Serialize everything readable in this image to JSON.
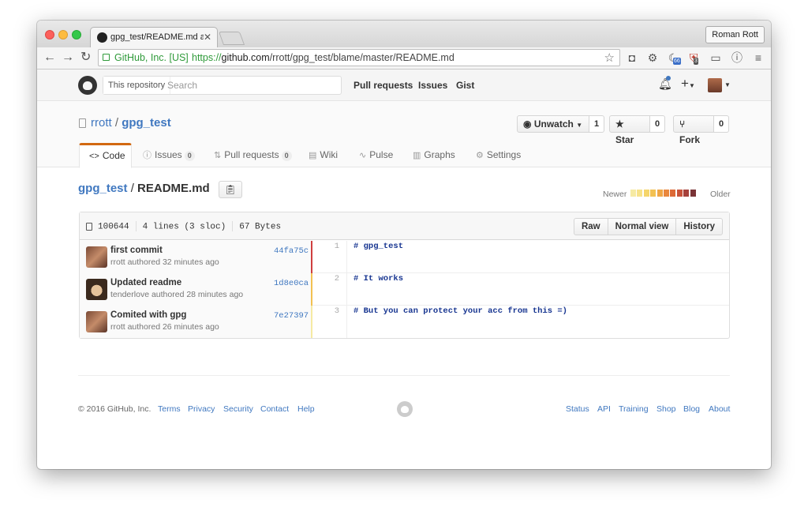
{
  "browser": {
    "tab_title": "gpg_test/README.md at m",
    "profile_name": "Roman Rott",
    "ssl_org": "GitHub, Inc. [US]",
    "url_scheme": "https://",
    "url_host": "github.com",
    "url_path": "/rrott/gpg_test/blame/master/README.md",
    "ext_badge_1": "66",
    "ext_badge_2": "3"
  },
  "header": {
    "search_scope": "This repository",
    "search_placeholder": "Search",
    "nav": [
      "Pull requests",
      "Issues",
      "Gist"
    ]
  },
  "repo": {
    "owner": "rrott",
    "separator": "/",
    "name": "gpg_test",
    "unwatch_label": "Unwatch",
    "unwatch_count": "1",
    "star_label": "Star",
    "star_count": "0",
    "fork_label": "Fork",
    "fork_count": "0"
  },
  "reponav": {
    "code": "Code",
    "issues": "Issues",
    "issues_count": "0",
    "pulls": "Pull requests",
    "pulls_count": "0",
    "wiki": "Wiki",
    "pulse": "Pulse",
    "graphs": "Graphs",
    "settings": "Settings"
  },
  "file": {
    "repo": "gpg_test",
    "separator": "/",
    "name": "README.md",
    "legend_newer": "Newer",
    "legend_older": "Older",
    "legend_colors": [
      "#f6eaa3",
      "#f7e28a",
      "#f5d56b",
      "#f3c152",
      "#efa646",
      "#e9873d",
      "#dd6a37",
      "#c8533a",
      "#a6413b",
      "#7a3437"
    ],
    "mode": "100644",
    "lines": "4 lines (3 sloc)",
    "size": "67 Bytes",
    "buttons": [
      "Raw",
      "Normal view",
      "History"
    ]
  },
  "blame": [
    {
      "message": "first commit",
      "meta": "rrott authored 32 minutes ago",
      "sha": "44fa75c",
      "line": "1",
      "code": "# gpg_test",
      "bar_color": "#cf3f3f"
    },
    {
      "message": "Updated readme",
      "meta": "tenderlove authored 28 minutes ago",
      "sha": "1d8e0ca",
      "line": "2",
      "code": "# It works",
      "bar_color": "#f3c152"
    },
    {
      "message": "Comited with gpg",
      "meta": "rrott authored 26 minutes ago",
      "sha": "7e27397",
      "line": "3",
      "code": "# But you can protect your acc from this =)",
      "bar_color": "#f6eaa3"
    }
  ],
  "footer": {
    "copyright": "© 2016 GitHub, Inc.",
    "left_links": [
      "Terms",
      "Privacy",
      "Security",
      "Contact",
      "Help"
    ],
    "right_links": [
      "Status",
      "API",
      "Training",
      "Shop",
      "Blog",
      "About"
    ]
  }
}
